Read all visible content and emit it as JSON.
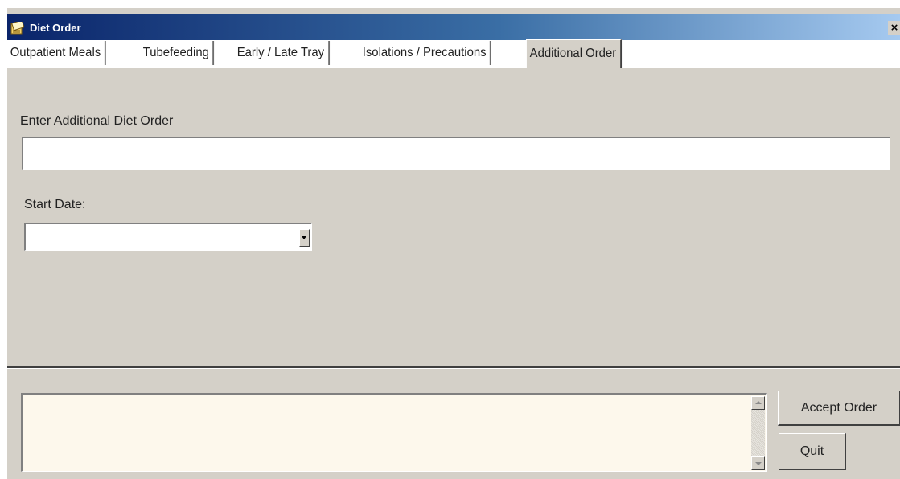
{
  "window": {
    "title": "Diet Order",
    "close_glyph": "×",
    "app_icon": "notepad-icon"
  },
  "tabs": [
    {
      "label": "Outpatient Meals",
      "active": false
    },
    {
      "label": "Tubefeeding",
      "active": false
    },
    {
      "label": "Early / Late Tray",
      "active": false
    },
    {
      "label": "Isolations / Precautions",
      "active": false
    },
    {
      "label": "Additional Order",
      "active": true
    }
  ],
  "form": {
    "additional_order_label": "Enter Additional Diet Order",
    "additional_order_value": "",
    "start_date_label": "Start Date:",
    "start_date_value": ""
  },
  "bottom": {
    "notes_value": "",
    "accept_button": "Accept Order",
    "quit_button": "Quit"
  },
  "colors": {
    "titlebar_start": "#0a246a",
    "titlebar_end": "#a6caf0",
    "face": "#d4d0c8",
    "notes_background": "#fdf8ec"
  }
}
